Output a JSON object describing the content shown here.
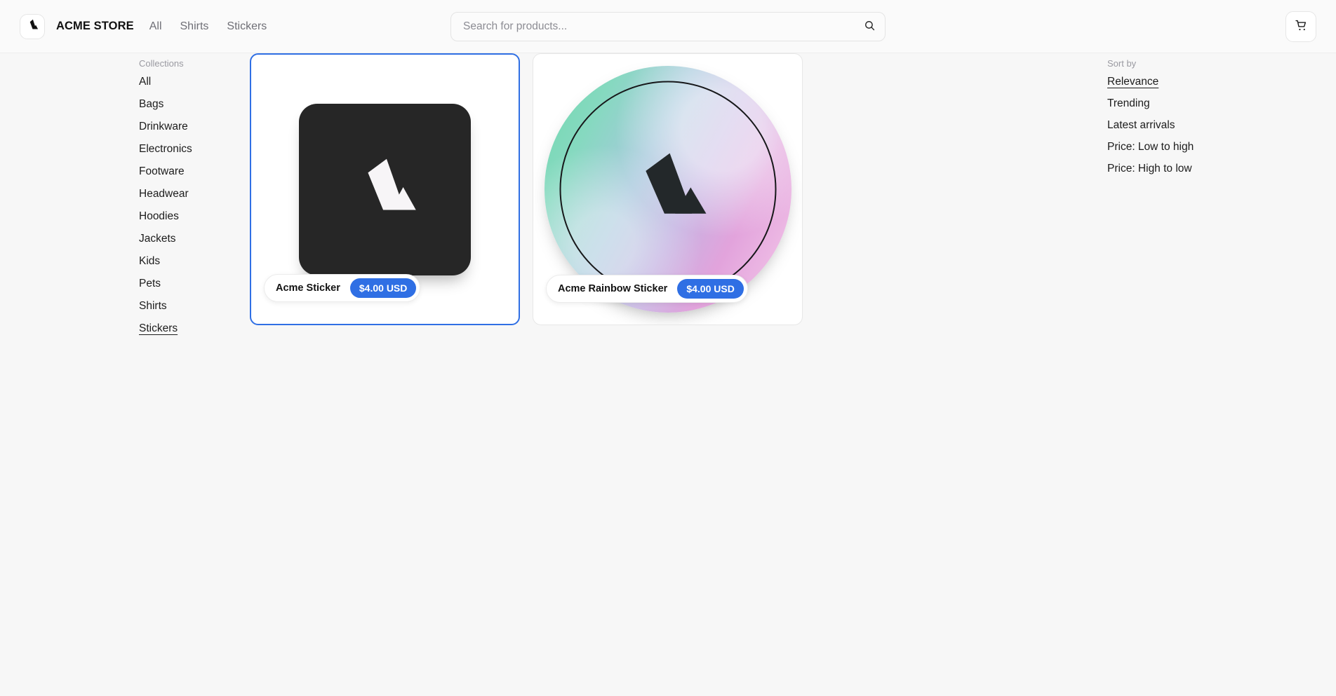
{
  "header": {
    "brand": "ACME STORE",
    "logo_icon": "acme-triangle-logo",
    "nav": [
      {
        "label": "All"
      },
      {
        "label": "Shirts"
      },
      {
        "label": "Stickers"
      }
    ],
    "search": {
      "placeholder": "Search for products...",
      "value": "",
      "icon": "search-icon"
    },
    "cart": {
      "icon": "shopping-cart-icon"
    }
  },
  "sidebar": {
    "heading": "Collections",
    "items": [
      {
        "label": "All",
        "active": false
      },
      {
        "label": "Bags",
        "active": false
      },
      {
        "label": "Drinkware",
        "active": false
      },
      {
        "label": "Electronics",
        "active": false
      },
      {
        "label": "Footware",
        "active": false
      },
      {
        "label": "Headwear",
        "active": false
      },
      {
        "label": "Hoodies",
        "active": false
      },
      {
        "label": "Jackets",
        "active": false
      },
      {
        "label": "Kids",
        "active": false
      },
      {
        "label": "Pets",
        "active": false
      },
      {
        "label": "Shirts",
        "active": false
      },
      {
        "label": "Stickers",
        "active": true
      }
    ]
  },
  "sort": {
    "heading": "Sort by",
    "options": [
      {
        "label": "Relevance",
        "active": true
      },
      {
        "label": "Trending",
        "active": false
      },
      {
        "label": "Latest arrivals",
        "active": false
      },
      {
        "label": "Price: Low to high",
        "active": false
      },
      {
        "label": "Price: High to low",
        "active": false
      }
    ]
  },
  "products": [
    {
      "title": "Acme Sticker",
      "price": "$4.00 USD",
      "image_kind": "dark-square-sticker",
      "selected": true
    },
    {
      "title": "Acme Rainbow Sticker",
      "price": "$4.00 USD",
      "image_kind": "holographic-round-sticker",
      "selected": false
    }
  ],
  "colors": {
    "accent_blue": "#2f6fe4",
    "page_background": "#f7f7f7",
    "sticker_dark": "#262626",
    "holo_green": "#6fd9ad",
    "holo_pink": "#e2a3dc"
  }
}
